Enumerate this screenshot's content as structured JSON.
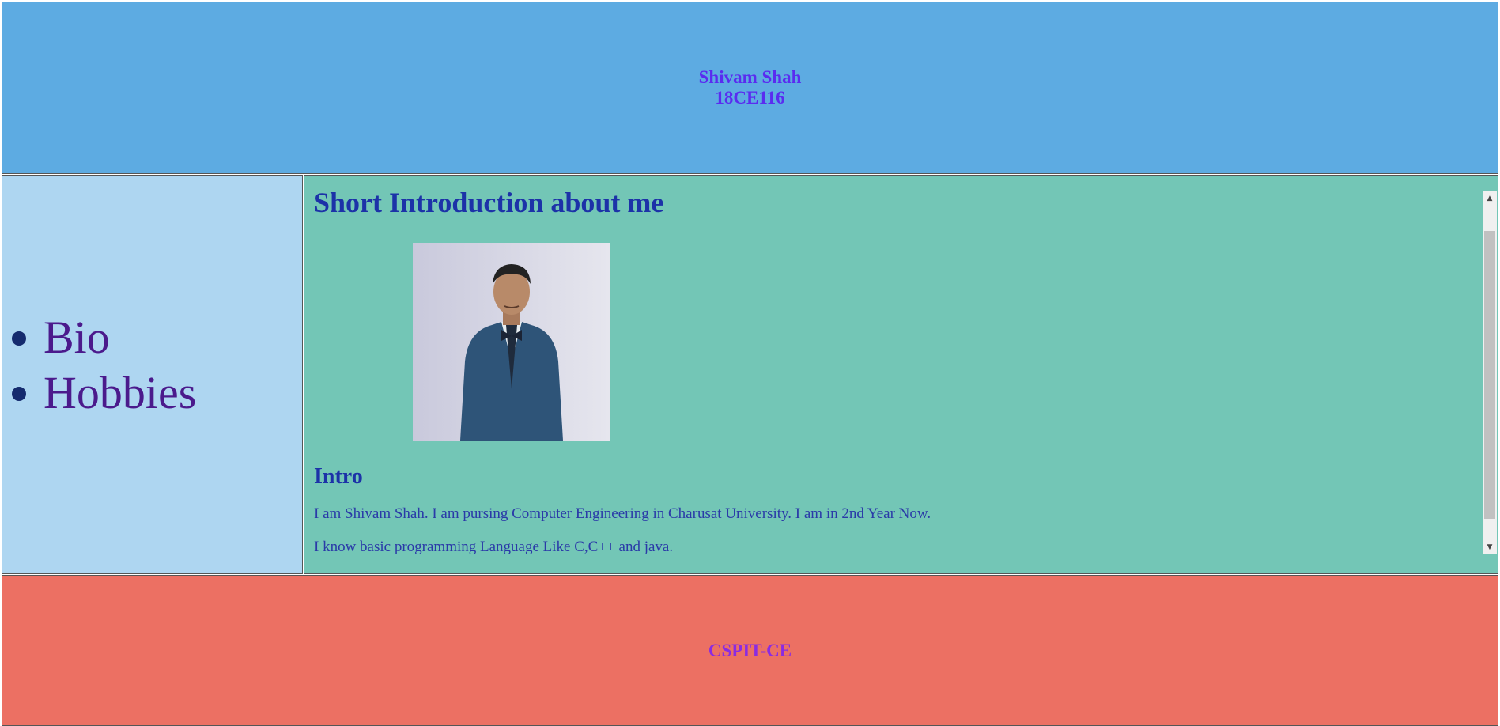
{
  "header": {
    "name": "Shivam Shah",
    "id": "18CE116"
  },
  "nav": {
    "items": [
      {
        "label": "Bio"
      },
      {
        "label": "Hobbies"
      }
    ]
  },
  "main": {
    "heading": "Short Introduction about me",
    "intro_heading": "Intro",
    "paragraphs": [
      "I am Shivam Shah. I am pursing Computer Engineering in Charusat University. I am in 2nd Year Now.",
      "I know basic programming Language Like C,C++ and java."
    ]
  },
  "footer": {
    "text": "CSPIT-CE"
  },
  "colors": {
    "header_bg": "#5dabe2",
    "nav_bg": "#aed6f1",
    "main_bg": "#73c6b6",
    "footer_bg": "#ec7063"
  }
}
